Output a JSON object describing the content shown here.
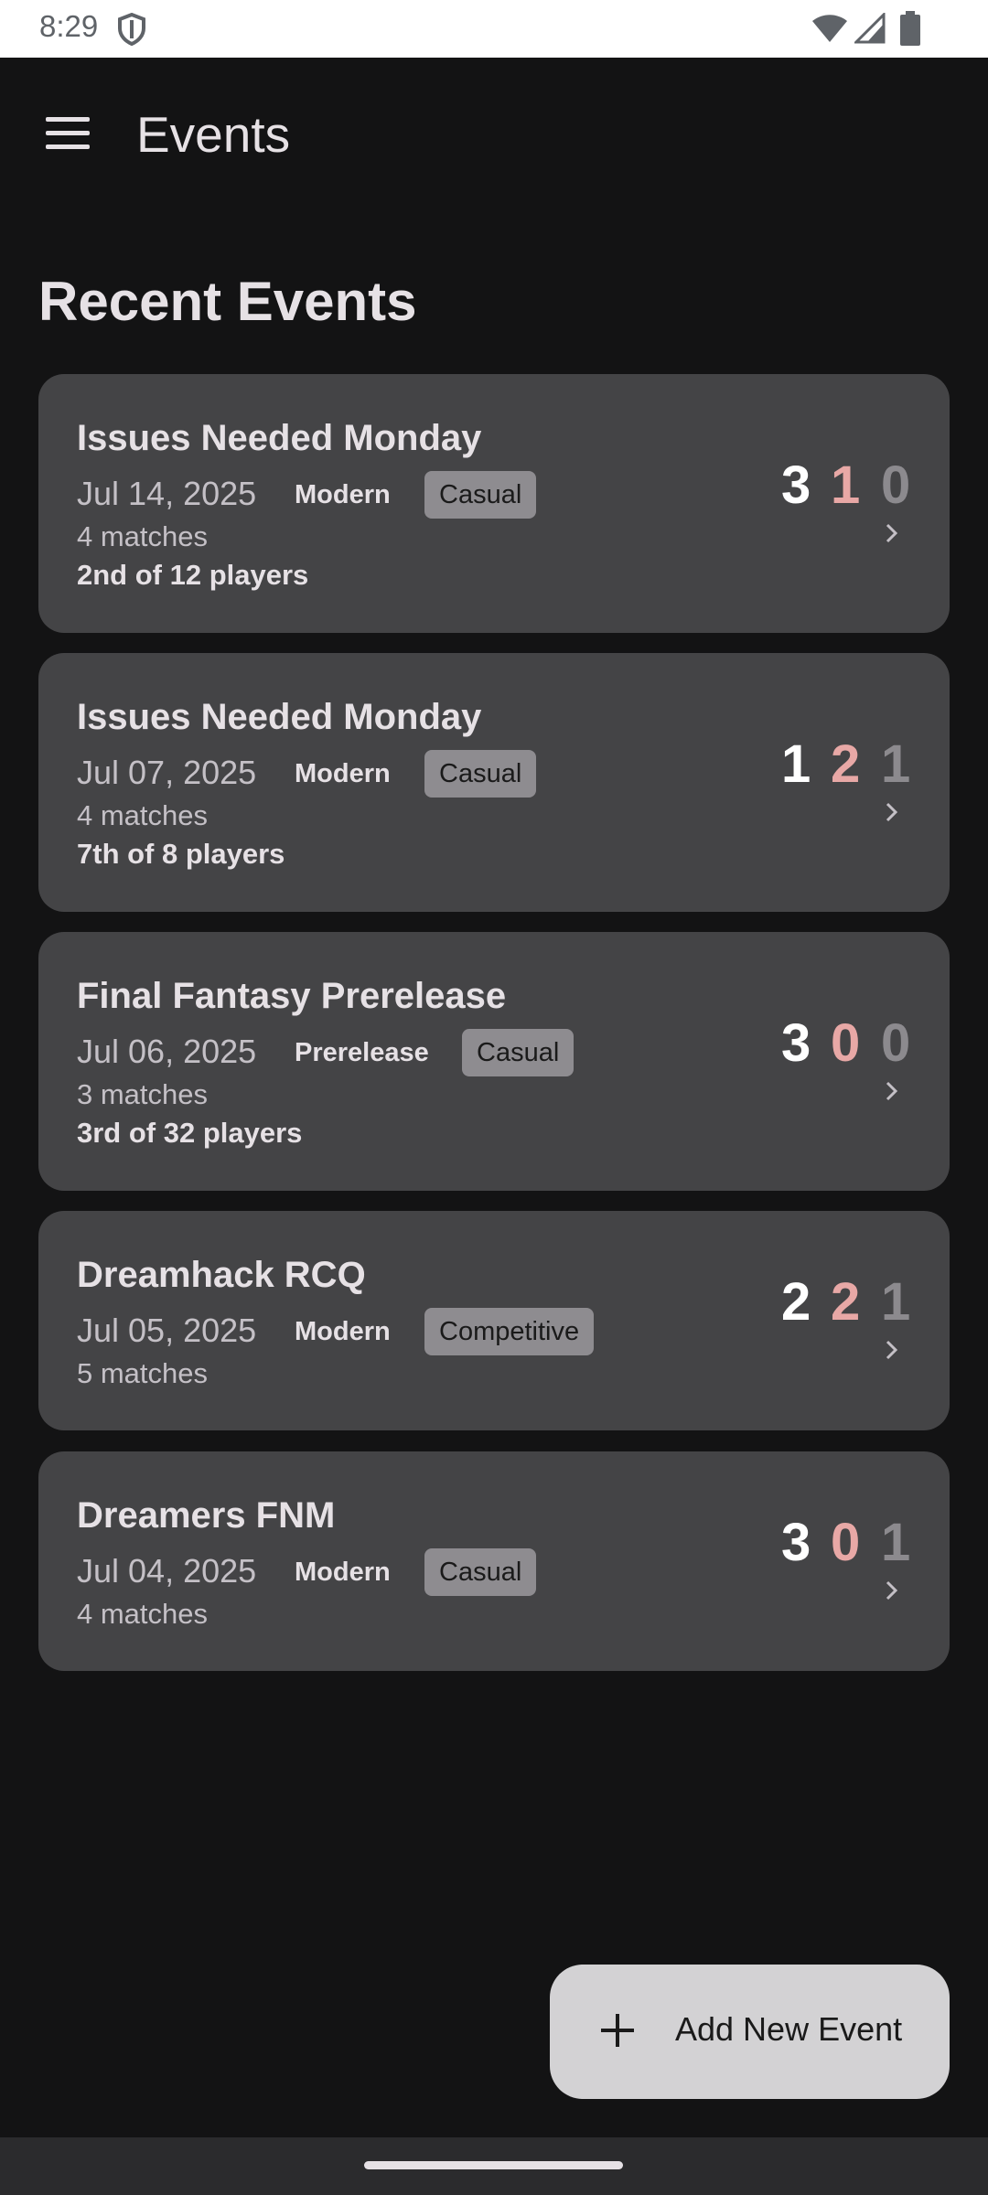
{
  "status_bar": {
    "time": "8:29"
  },
  "app_bar": {
    "title": "Events"
  },
  "section": {
    "title": "Recent Events"
  },
  "events": [
    {
      "name": "Issues Needed Monday",
      "date": "Jul 14, 2025",
      "format": "Modern",
      "tag": "Casual",
      "matches": "4 matches",
      "placement": "2nd of 12 players",
      "wins": "3",
      "losses": "1",
      "draws": "0"
    },
    {
      "name": "Issues Needed Monday",
      "date": "Jul 07, 2025",
      "format": "Modern",
      "tag": "Casual",
      "matches": "4 matches",
      "placement": "7th of 8 players",
      "wins": "1",
      "losses": "2",
      "draws": "1"
    },
    {
      "name": "Final Fantasy Prerelease",
      "date": "Jul 06, 2025",
      "format": "Prerelease",
      "tag": "Casual",
      "matches": "3 matches",
      "placement": "3rd of 32 players",
      "wins": "3",
      "losses": "0",
      "draws": "0"
    },
    {
      "name": "Dreamhack RCQ",
      "date": "Jul 05, 2025",
      "format": "Modern",
      "tag": "Competitive",
      "matches": "5 matches",
      "placement": "",
      "wins": "2",
      "losses": "2",
      "draws": "1"
    },
    {
      "name": "Dreamers FNM",
      "date": "Jul 04, 2025",
      "format": "Modern",
      "tag": "Casual",
      "matches": "4 matches",
      "placement": "",
      "wins": "3",
      "losses": "0",
      "draws": "1"
    }
  ],
  "fab": {
    "label": "Add New Event",
    "icon": "plus-icon"
  },
  "colors": {
    "background": "#131314",
    "card": "#444446",
    "win": "#ffffff",
    "loss": "#e8a8a6",
    "draw": "#8c8a8e",
    "fab": "#d3d2d4"
  }
}
